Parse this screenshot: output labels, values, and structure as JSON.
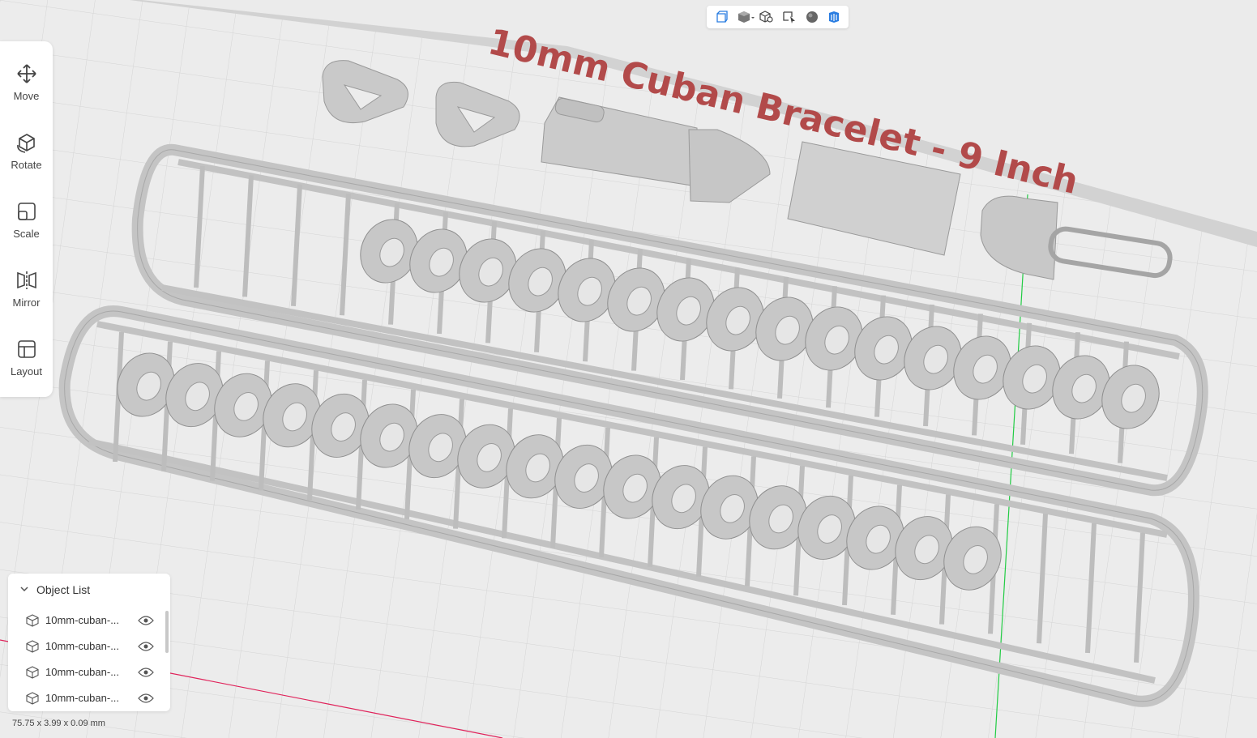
{
  "toolbar": {
    "items": [
      {
        "label": "Move",
        "icon": "move-icon"
      },
      {
        "label": "Rotate",
        "icon": "rotate-icon"
      },
      {
        "label": "Scale",
        "icon": "scale-icon"
      },
      {
        "label": "Mirror",
        "icon": "mirror-icon"
      },
      {
        "label": "Layout",
        "icon": "layout-icon"
      }
    ]
  },
  "viewbar": {
    "icons": [
      "view-cube-icon",
      "shaded-box-icon",
      "inspect-box-icon",
      "select-box-icon",
      "sphere-icon",
      "scene-icon"
    ]
  },
  "scene": {
    "model_label": "10mm Cuban Bracelet - 9 Inch",
    "label_color": "#b24a4a",
    "background_color": "#ececec",
    "part_color": "#cfcfcf",
    "x_axis_color": "#e0225a",
    "y_axis_color": "#22cc44"
  },
  "object_list": {
    "title": "Object List",
    "items": [
      {
        "name": "10mm-cuban-..."
      },
      {
        "name": "10mm-cuban-..."
      },
      {
        "name": "10mm-cuban-..."
      },
      {
        "name": "10mm-cuban-..."
      }
    ]
  },
  "status": {
    "dimensions": "75.75 x 3.99 x 0.09 mm"
  }
}
